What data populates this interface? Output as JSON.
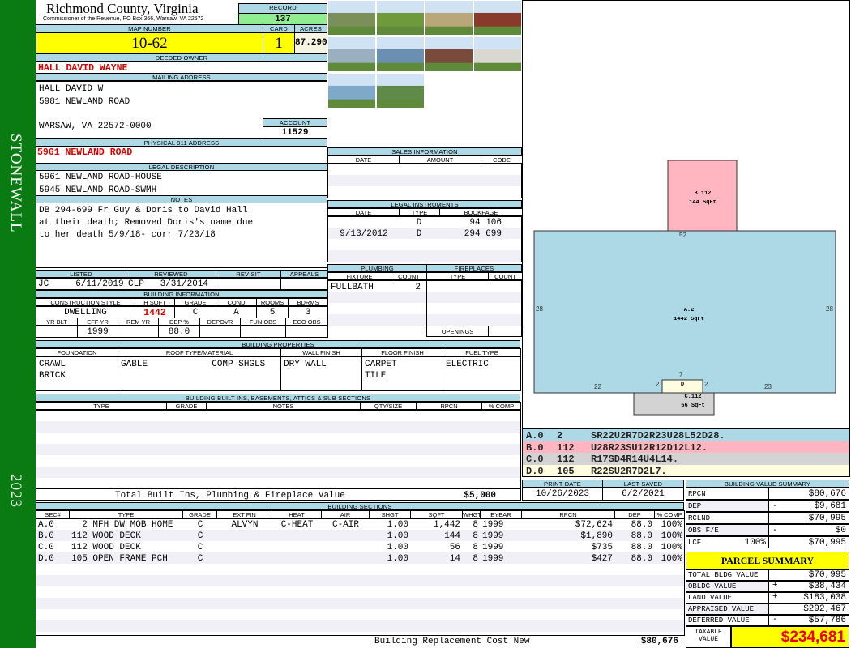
{
  "sidebar": {
    "district": "STONEWALL",
    "year": "2023"
  },
  "header": {
    "county": "Richmond County, Virginia",
    "office": "Commissioner of the Reuenue, PO Box 366, Warsaw, VA 22572",
    "record_label": "RECORD",
    "record": "137"
  },
  "parcel": {
    "map_label": "MAP NUMBER",
    "map": "10-62",
    "card_label": "CARD",
    "card": "1",
    "acres_label": "ACRES",
    "acres": "87.2900"
  },
  "owner": {
    "label": "DEEDED OWNER",
    "name": "HALL DAVID WAYNE"
  },
  "mailing": {
    "label": "MAILING ADDRESS",
    "lines": [
      "HALL DAVID W",
      "5981 NEWLAND ROAD",
      "",
      "WARSAW, VA 22572-0000"
    ],
    "account_label": "ACCOUNT",
    "account": "11529"
  },
  "physical": {
    "label": "PHYSICAL 911 ADDRESS",
    "address": "5961 NEWLAND ROAD"
  },
  "legal": {
    "label": "LEGAL DESCRIPTION",
    "lines": [
      "5961 NEWLAND ROAD-HOUSE",
      "5945 NEWLAND ROAD-SWMH"
    ]
  },
  "notes": {
    "label": "NOTES",
    "lines": [
      "DB 294-699 Fr Guy & Doris to David Hall",
      "at their death; Removed Doris's name due",
      "to her death 5/9/18- corr 7/23/18"
    ]
  },
  "listing": {
    "headers": [
      "LISTED",
      "REVIEWED",
      "REVISIT",
      "APPEALS"
    ],
    "values": [
      "JC     6/11/2019",
      "CLP   3/31/2014",
      "",
      ""
    ]
  },
  "building_info": {
    "label": "BUILDING INFORMATION",
    "headers1": [
      "CONSTRUCTION STYLE",
      "H SQFT",
      "GRADE",
      "COND",
      "ROOMS",
      "BDRMS"
    ],
    "values1": [
      "DWELLING",
      "1442",
      "C",
      "A",
      "5",
      "3"
    ],
    "headers2": [
      "YR BLT",
      "EFF YR",
      "REM YR",
      "DEP %",
      "DEPOVR",
      "FUN OBS",
      "ECO OBS"
    ],
    "values2": [
      "",
      "1999",
      "",
      "88.0",
      "",
      "",
      ""
    ]
  },
  "building_properties": {
    "label": "BUILDING PROPERTIES",
    "headers": [
      "FOUNDATION",
      "ROOF TYPE/MATERIAL",
      "WALL FINISH",
      "FLOOR FINISH",
      "FUEL TYPE"
    ],
    "values": [
      [
        "CRAWL",
        "BRICK"
      ],
      [
        "GABLE            COMP SHGLS",
        ""
      ],
      [
        "DRY WALL",
        ""
      ],
      [
        "CARPET",
        "TILE"
      ],
      [
        "ELECTRIC",
        ""
      ]
    ]
  },
  "built_ins": {
    "label": "BUILDING BUILT INS, BASEMENTS, ATTICS & SUB SECTIONS",
    "headers": [
      "TYPE",
      "GRADE",
      "NOTES",
      "QTY/SIZE",
      "RPCN",
      "% COMP"
    ],
    "total_label": "Total Built Ins, Plumbing & Fireplace Value",
    "total_value": "$5,000"
  },
  "building_sections": {
    "label": "BUILDING SECTIONS",
    "headers": [
      "SEC#",
      "TYPE",
      "GRADE",
      "EXT FIN",
      "HEAT",
      "AIR",
      "SHGT",
      "SQFT",
      "WHGT",
      "EYEAR",
      "RPCN",
      "DEP",
      "% COMP"
    ],
    "rows": [
      [
        "A.0",
        "  2 MFH DW MOB HOME",
        "C",
        "ALVYN",
        "C-HEAT",
        "C-AIR",
        "1.00",
        "1,442",
        "8",
        "1999",
        "$72,624",
        "88.0",
        "100%"
      ],
      [
        "B.0",
        "112 WOOD DECK",
        "C",
        "",
        "",
        "",
        "1.00",
        "144",
        "8",
        "1999",
        "$1,890",
        "88.0",
        "100%"
      ],
      [
        "C.0",
        "112 WOOD DECK",
        "C",
        "",
        "",
        "",
        "1.00",
        "56",
        "8",
        "1999",
        "$735",
        "88.0",
        "100%"
      ],
      [
        "D.0",
        "105 OPEN FRAME PCH",
        "C",
        "",
        "",
        "",
        "1.00",
        "14",
        "8",
        "1999",
        "$427",
        "88.0",
        "100%"
      ]
    ],
    "footer_label": "Building Replacement Cost New",
    "footer_value": "$80,676"
  },
  "sales": {
    "label": "SALES INFORMATION",
    "headers": [
      "DATE",
      "AMOUNT",
      "CODE"
    ]
  },
  "legal_instruments": {
    "label": "LEGAL INSTRUMENTS",
    "headers": [
      "DATE",
      "TYPE",
      "BOOKPAGE"
    ],
    "rows": [
      [
        "",
        "D",
        "94 106"
      ],
      [
        "9/13/2012",
        "D",
        "294 699"
      ]
    ]
  },
  "plumbing": {
    "label": "PLUMBING",
    "headers": [
      "FIXTURE",
      "COUNT"
    ],
    "rows": [
      [
        "FULLBATH",
        "2"
      ]
    ]
  },
  "fireplaces": {
    "label": "FIREPLACES",
    "headers": [
      "TYPE",
      "COUNT"
    ],
    "openings_label": "OPENINGS"
  },
  "photos": [
    "#7a8f5a",
    "#6f9a3c",
    "#b9a77a",
    "#8a3a2a",
    "#9ab0c0",
    "#6b8fb0",
    "#7a4a3a",
    "#d8d8d0",
    "#7fa9c8",
    "#5f8a4a"
  ],
  "sketch": {
    "a_label": "A.2",
    "a_area": "1442 SqFt",
    "b_label": "B.112",
    "b_area": "144 SqFt",
    "c_label": "C.112",
    "c_area": "56 SqFt",
    "d_label": "D",
    "dims": {
      "top": "52",
      "left": "28",
      "right": "28",
      "bottom_left": "22",
      "bottom_right": "23",
      "porch_top": "7",
      "porch_left": "2",
      "porch_right": "2"
    },
    "codes": [
      {
        "sec": "A.0",
        "code": "2",
        "path": "SR22U2R7D2R23U28L52D28.",
        "color": "#add8e6"
      },
      {
        "sec": "B.0",
        "code": "112",
        "path": "U28R23SU12R12D12L12.",
        "color": "#ffb6c1"
      },
      {
        "sec": "C.0",
        "code": "112",
        "path": "R17SD4R14U4L14.",
        "color": "#d3d3d3"
      },
      {
        "sec": "D.0",
        "code": "105",
        "path": "R22SU2R7D2L7.",
        "color": "#fffde0"
      }
    ]
  },
  "dates": {
    "print_label": "PRINT DATE",
    "print": "10/26/2023",
    "saved_label": "LAST SAVED",
    "saved": "6/2/2021"
  },
  "value_summary": {
    "label": "BUILDING VALUE SUMMARY",
    "rows": [
      {
        "label": "RPCN",
        "extra": "",
        "sign": "",
        "value": "$80,676"
      },
      {
        "label": "DEP",
        "extra": "",
        "sign": "-",
        "value": "$9,681"
      },
      {
        "label": "RCLND",
        "extra": "",
        "sign": "",
        "value": "$70,995"
      },
      {
        "label": "OBS F/E",
        "extra": "",
        "sign": "-",
        "value": "$0"
      },
      {
        "label": "LCF",
        "extra": "100%",
        "sign": "",
        "value": "$70,995"
      }
    ]
  },
  "parcel_summary": {
    "label": "PARCEL SUMMARY",
    "rows": [
      {
        "label": "TOTAL BLDG VALUE",
        "sign": "",
        "value": "$70,995"
      },
      {
        "label": "OBLDG VALUE",
        "sign": "+",
        "value": "$38,434"
      },
      {
        "label": "LAND VALUE",
        "sign": "+",
        "value": "$183,038"
      },
      {
        "label": "APPRAISED VALUE",
        "sign": "",
        "value": "$292,467"
      },
      {
        "label": "DEFERRED VALUE",
        "sign": "-",
        "value": "$57,786"
      }
    ],
    "taxable_label": "TAXABLE\nVALUE",
    "taxable": "$234,681"
  }
}
